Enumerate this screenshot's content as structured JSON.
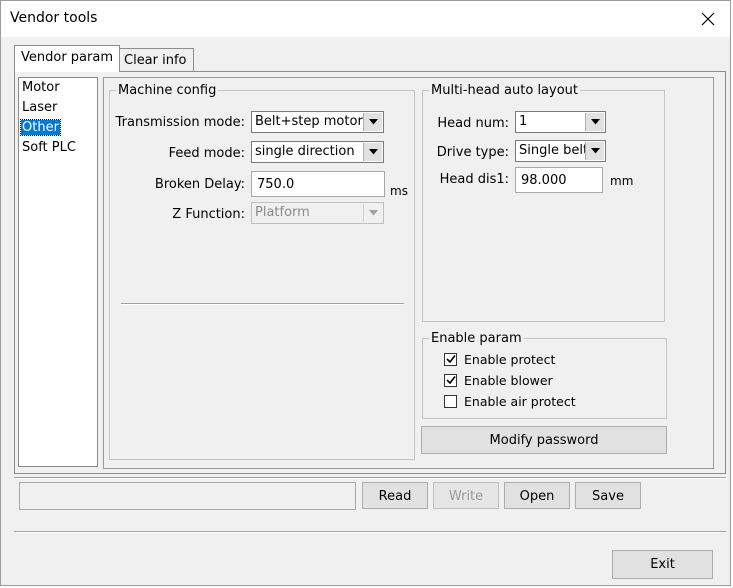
{
  "window": {
    "title": "Vendor tools"
  },
  "tabs": [
    {
      "label": "Vendor param",
      "active": true
    },
    {
      "label": "Clear info",
      "active": false
    }
  ],
  "sidebar": {
    "items": [
      {
        "label": "Motor",
        "selected": false
      },
      {
        "label": "Laser",
        "selected": false
      },
      {
        "label": "Other",
        "selected": true
      },
      {
        "label": "Soft PLC",
        "selected": false
      }
    ]
  },
  "machine_config": {
    "title": "Machine config",
    "transmission_mode": {
      "label": "Transmission mode:",
      "value": "Belt+step motor"
    },
    "feed_mode": {
      "label": "Feed mode:",
      "value": "single direction"
    },
    "broken_delay": {
      "label": "Broken Delay:",
      "value": "750.0",
      "unit": "ms"
    },
    "z_function": {
      "label": "Z Function:",
      "value": "Platform",
      "enabled": false
    }
  },
  "multi_head": {
    "title": "Multi-head auto layout",
    "head_num": {
      "label": "Head num:",
      "value": "1"
    },
    "drive_type": {
      "label": "Drive type:",
      "value": "Single belt"
    },
    "head_dis1": {
      "label": "Head dis1:",
      "value": "98.000",
      "unit": "mm"
    }
  },
  "enable_param": {
    "title": "Enable param",
    "items": [
      {
        "label": "Enable protect",
        "checked": true
      },
      {
        "label": "Enable blower",
        "checked": true
      },
      {
        "label": "Enable air protect",
        "checked": false
      }
    ]
  },
  "modify_password_label": "Modify password",
  "bottom": {
    "status_value": "",
    "read_label": "Read",
    "write_label": "Write",
    "open_label": "Open",
    "save_label": "Save"
  },
  "exit_label": "Exit"
}
